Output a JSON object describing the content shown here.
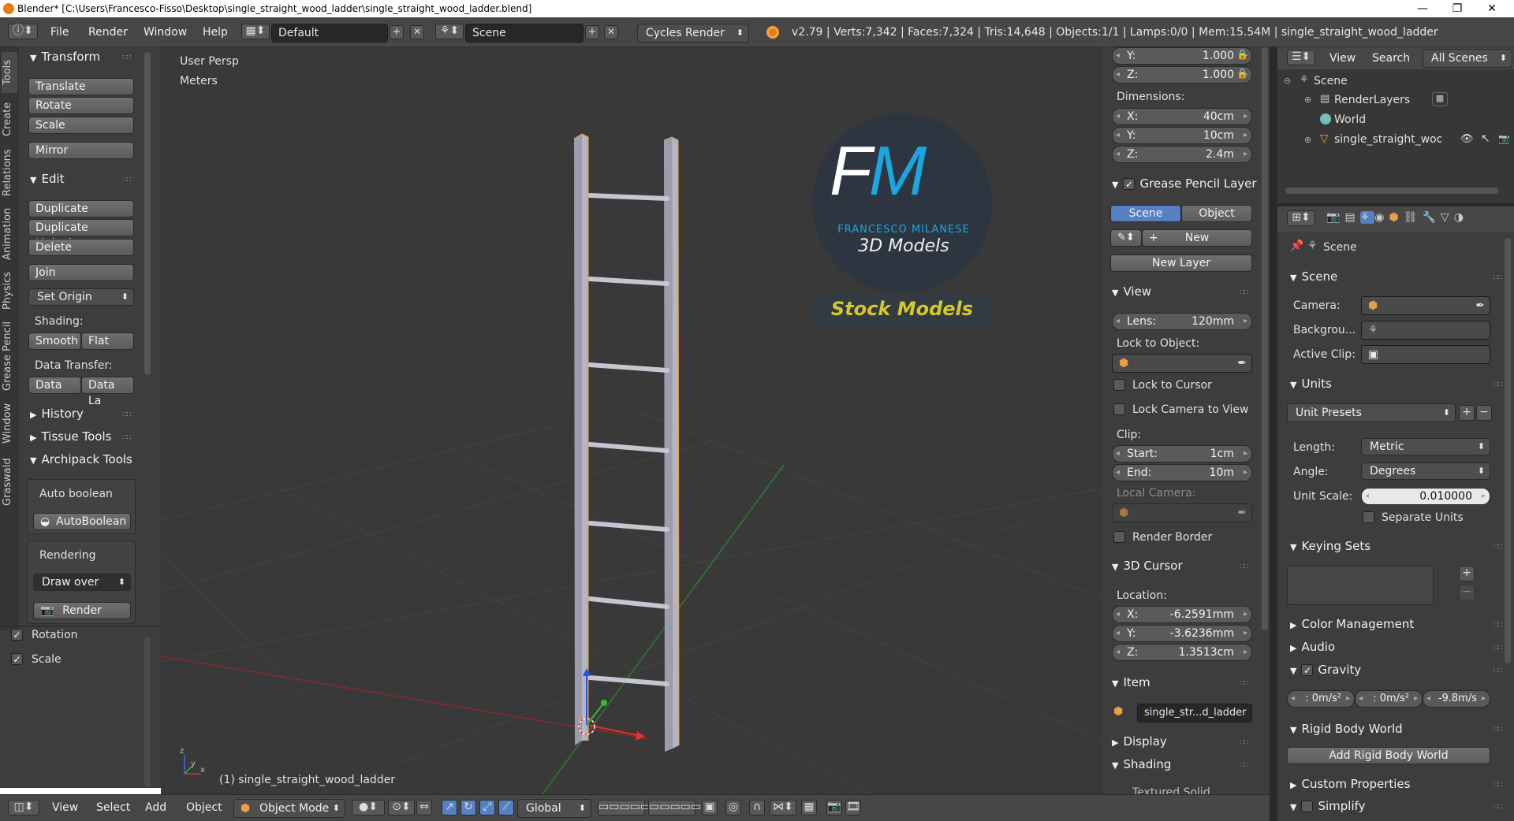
{
  "window": {
    "title": "Blender* [C:\\Users\\Francesco-Fisso\\Desktop\\single_straight_wood_ladder\\single_straight_wood_ladder.blend]",
    "min": "—",
    "max": "❐",
    "close": "✕"
  },
  "topbar": {
    "menus": [
      "File",
      "Render",
      "Window",
      "Help"
    ],
    "layout": "Default",
    "scene": "Scene",
    "engine": "Cycles Render",
    "stats": "v2.79 | Verts:7,342 | Faces:7,324 | Tris:14,648 | Objects:1/1 | Lamps:0/0 | Mem:15.54M | single_straight_wood_ladder"
  },
  "lefttabs": [
    "Tools",
    "Create",
    "Relations",
    "Animation",
    "Physics",
    "Grease Pencil",
    "Window",
    "Graswald"
  ],
  "tools": {
    "transform": "Transform",
    "translate": "Translate",
    "rotate": "Rotate",
    "scale": "Scale",
    "mirror": "Mirror",
    "edit": "Edit",
    "duplicate": "Duplicate",
    "duplicate_linked": "Duplicate Linked",
    "delete": "Delete",
    "join": "Join",
    "set_origin": "Set Origin",
    "shading": "Shading:",
    "smooth": "Smooth",
    "flat": "Flat",
    "data_transfer": "Data Transfer:",
    "data": "Data",
    "data_la": "Data La",
    "history": "History",
    "tissue": "Tissue Tools",
    "archipack": "Archipack Tools",
    "auto_boolean": "Auto boolean",
    "autoboolean_btn": "AutoBoolean",
    "rendering": "Rendering",
    "draw_over": "Draw over",
    "render": "Render",
    "rotation": "Rotation",
    "scale_opt": "Scale"
  },
  "viewport": {
    "persp": "User Persp",
    "units": "Meters",
    "object": "(1) single_straight_wood_ladder",
    "logo_fm": "FM",
    "logo_name": "FRANCESCO MILANESE",
    "logo_sub": "3D Models",
    "logo_stock": "Stock Models"
  },
  "npanel": {
    "scale_y": "1.000",
    "scale_z": "1.000",
    "dimensions": "Dimensions:",
    "dim_x": "40cm",
    "dim_y": "10cm",
    "dim_z": "2.4m",
    "grease": "Grease Pencil Layer",
    "scene_tab": "Scene",
    "object_tab": "Object",
    "new": "New",
    "new_layer": "New Layer",
    "view": "View",
    "lens_k": "Lens:",
    "lens": "120mm",
    "lock_obj": "Lock to Object:",
    "lock_cursor": "Lock to Cursor",
    "lock_cam": "Lock Camera to View",
    "clip": "Clip:",
    "start_k": "Start:",
    "start": "1cm",
    "end_k": "End:",
    "end": "10m",
    "local_cam": "Local Camera:",
    "render_border": "Render Border",
    "cursor": "3D Cursor",
    "location": "Location:",
    "cx": "-6.2591mm",
    "cy": "-3.6236mm",
    "cz": "1.3513cm",
    "item": "Item",
    "item_name": "single_str...d_ladder",
    "display": "Display",
    "shading": "Shading",
    "textured": "Textured Solid"
  },
  "outliner": {
    "view": "View",
    "search": "Search",
    "all_scenes": "All Scenes",
    "scene": "Scene",
    "renderlayers": "RenderLayers",
    "world": "World",
    "obj": "single_straight_wood_l"
  },
  "props": {
    "scene": "Scene",
    "scene_panel": "Scene",
    "camera": "Camera:",
    "background": "Backgrou...",
    "active_clip": "Active Clip:",
    "units": "Units",
    "unit_presets": "Unit Presets",
    "length_k": "Length:",
    "length": "Metric",
    "angle_k": "Angle:",
    "angle": "Degrees",
    "unit_scale_k": "Unit Scale:",
    "unit_scale": "0.010000",
    "separate": "Separate Units",
    "keying": "Keying Sets",
    "color_mgmt": "Color Management",
    "audio": "Audio",
    "gravity": "Gravity",
    "gx": ": 0m/s²",
    "gy": ": 0m/s²",
    "gz": "-9.8m/s",
    "rigid": "Rigid Body World",
    "add_rigid": "Add Rigid Body World",
    "custom": "Custom Properties",
    "simplify": "Simplify"
  },
  "bottombar": {
    "view": "View",
    "select": "Select",
    "add": "Add",
    "object": "Object",
    "mode": "Object Mode",
    "orientation": "Global"
  },
  "colors": {
    "accent": "#5680c2",
    "logo_blue": "#1aa7e0",
    "logo_yellow": "#d4c82a"
  }
}
